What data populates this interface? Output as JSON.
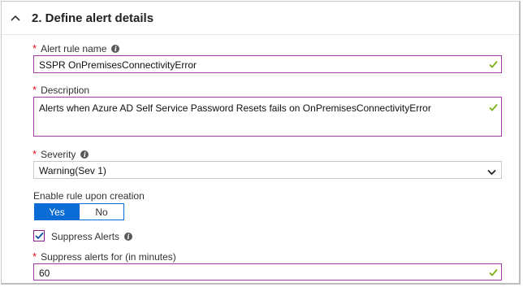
{
  "section": {
    "title": "2. Define alert details",
    "icon": "chevron-up-icon"
  },
  "alert_rule_name": {
    "label": "Alert rule name",
    "value": "SSPR OnPremisesConnectivityError"
  },
  "description": {
    "label": "Description",
    "value": "Alerts when Azure AD Self Service Password Resets fails on OnPremisesConnectivityError"
  },
  "severity": {
    "label": "Severity",
    "value": "Warning(Sev 1)"
  },
  "enable_rule": {
    "label": "Enable rule upon creation",
    "options": [
      "Yes",
      "No"
    ],
    "selected": "Yes"
  },
  "suppress_alerts": {
    "label": "Suppress Alerts",
    "checked": true
  },
  "suppress_for": {
    "label": "Suppress alerts for (in minutes)",
    "value": "60"
  },
  "colors": {
    "required": "#e00b1c",
    "accent": "#0b6cd6",
    "valid_border": "#a23ba6",
    "check": "#7ab317"
  }
}
